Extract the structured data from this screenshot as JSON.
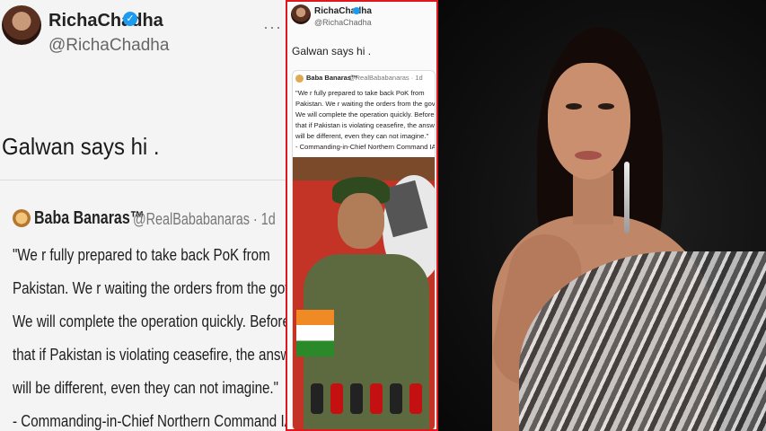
{
  "tweet": {
    "display_name": "RichaChadha",
    "handle": "@RichaChadha",
    "more_label": "···",
    "verified_label": "✓",
    "text": "Galwan says hi ."
  },
  "quoted_tweet": {
    "name": "Baba Banaras™",
    "handle_meta": "@RealBababanaras · 1d",
    "lines_large": [
      "\"We r fully prepared to take back PoK from",
      "Pakistan. We r waiting the orders from the govt.",
      "We will complete the operation quickly. Before",
      "that if Pakistan is violating ceasefire, the answer",
      "will be different, even they can not imagine.\"",
      "- Commanding-in-Chief Northern Command IA"
    ],
    "lines_small": [
      "\"We r fully prepared to take back PoK from",
      "Pakistan. We r waiting the orders from the govt.",
      "We will complete the operation quickly. Before",
      "that if Pakistan is violating ceasefire, the answer",
      "will be different, even they can not imagine.\"",
      "- Commanding-in-Chief Northern Command IA"
    ]
  },
  "colors": {
    "accent_border": "#e0181e",
    "verified": "#1d9bf0"
  }
}
